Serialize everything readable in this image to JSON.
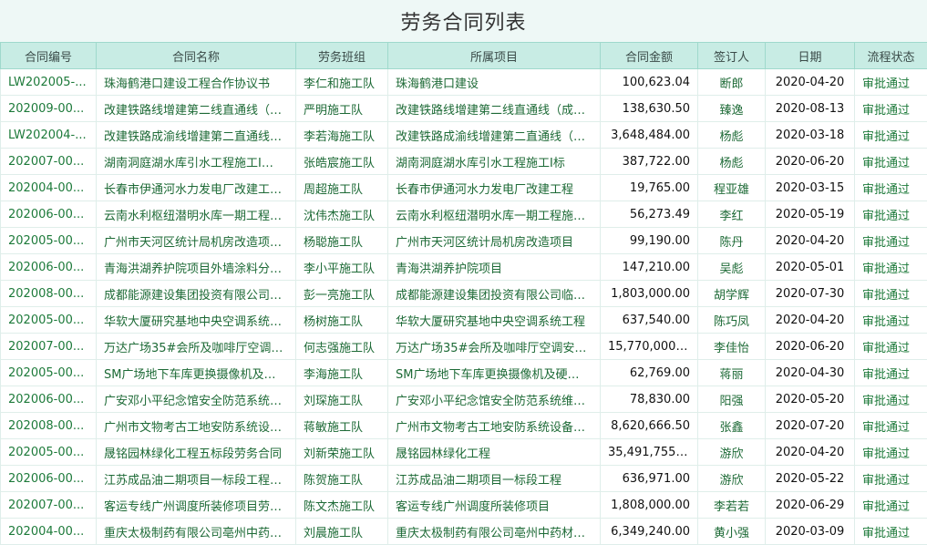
{
  "page": {
    "title": "劳务合同列表"
  },
  "columns": [
    "合同编号",
    "合同名称",
    "劳务班组",
    "所属项目",
    "合同金额",
    "签订人",
    "日期",
    "流程状态"
  ],
  "rows": [
    {
      "code": "LW202005-...",
      "name": "珠海鹤港口建设工程合作协议书",
      "team": "李仁和施工队",
      "project": "珠海鹤港口建设",
      "amount": "100,623.04",
      "signer": "断郎",
      "date": "2020-04-20",
      "status": "审批通过"
    },
    {
      "code": "202009-00...",
      "name": "改建铁路线增建第二线直通线（…",
      "team": "严明施工队",
      "project": "改建铁路线增建第二线直通线（成…",
      "amount": "138,630.50",
      "signer": "臻逸",
      "date": "2020-08-13",
      "status": "审批通过"
    },
    {
      "code": "LW202004-...",
      "name": "改建铁路成渝线增建第二直通线…",
      "team": "李若海施工队",
      "project": "改建铁路成渝线增建第二直通线（…",
      "amount": "3,648,484.00",
      "signer": "杨彪",
      "date": "2020-03-18",
      "status": "审批通过"
    },
    {
      "code": "202007-00...",
      "name": "湖南洞庭湖水库引水工程施工I…",
      "team": "张皓宸施工队",
      "project": "湖南洞庭湖水库引水工程施工I标",
      "amount": "387,722.00",
      "signer": "杨彪",
      "date": "2020-06-20",
      "status": "审批通过"
    },
    {
      "code": "202004-00...",
      "name": "长春市伊通河水力发电厂改建工…",
      "team": "周超施工队",
      "project": "长春市伊通河水力发电厂改建工程",
      "amount": "19,765.00",
      "signer": "程亚雄",
      "date": "2020-03-15",
      "status": "审批通过"
    },
    {
      "code": "202006-00...",
      "name": "云南水利枢纽潜明水库一期工程…",
      "team": "沈伟杰施工队",
      "project": "云南水利枢纽潜明水库一期工程施…",
      "amount": "56,273.49",
      "signer": "李红",
      "date": "2020-05-19",
      "status": "审批通过"
    },
    {
      "code": "202005-00...",
      "name": "广州市天河区统计局机房改造项…",
      "team": "杨聪施工队",
      "project": "广州市天河区统计局机房改造项目",
      "amount": "99,190.00",
      "signer": "陈丹",
      "date": "2020-04-20",
      "status": "审批通过"
    },
    {
      "code": "202006-00...",
      "name": "青海洪湖养护院项目外墙涂料分…",
      "team": "李小平施工队",
      "project": "青海洪湖养护院项目",
      "amount": "147,210.00",
      "signer": "吴彪",
      "date": "2020-05-01",
      "status": "审批通过"
    },
    {
      "code": "202008-00...",
      "name": "成都能源建设集团投资有限公司…",
      "team": "彭一亮施工队",
      "project": "成都能源建设集团投资有限公司临…",
      "amount": "1,803,000.00",
      "signer": "胡学辉",
      "date": "2020-07-30",
      "status": "审批通过"
    },
    {
      "code": "202005-00...",
      "name": "华软大厦研究基地中央空调系统…",
      "team": "杨树施工队",
      "project": "华软大厦研究基地中央空调系统工程",
      "amount": "637,540.00",
      "signer": "陈巧凤",
      "date": "2020-04-20",
      "status": "审批通过"
    },
    {
      "code": "202007-00...",
      "name": "万达广场35#会所及咖啡厅空调…",
      "team": "何志强施工队",
      "project": "万达广场35#会所及咖啡厅空调安…",
      "amount": "15,770,000.00",
      "signer": "李佳怡",
      "date": "2020-06-20",
      "status": "审批通过"
    },
    {
      "code": "202005-00...",
      "name": "SM广场地下车库更换摄像机及…",
      "team": "李海施工队",
      "project": "SM广场地下车库更换摄像机及硬…",
      "amount": "62,769.00",
      "signer": "蒋丽",
      "date": "2020-04-30",
      "status": "审批通过"
    },
    {
      "code": "202006-00...",
      "name": "广安邓小平纪念馆安全防范系统…",
      "team": "刘琛施工队",
      "project": "广安邓小平纪念馆安全防范系统维…",
      "amount": "78,830.00",
      "signer": "阳强",
      "date": "2020-05-20",
      "status": "审批通过"
    },
    {
      "code": "202008-00...",
      "name": "广州市文物考古工地安防系统设…",
      "team": "蒋敏施工队",
      "project": "广州市文物考古工地安防系统设备…",
      "amount": "8,620,666.50",
      "signer": "张鑫",
      "date": "2020-07-20",
      "status": "审批通过"
    },
    {
      "code": "202005-00...",
      "name": "晟铭园林绿化工程五标段劳务合同",
      "team": "刘新荣施工队",
      "project": "晟铭园林绿化工程",
      "amount": "35,491,755.80",
      "signer": "游欣",
      "date": "2020-04-20",
      "status": "审批通过"
    },
    {
      "code": "202006-00...",
      "name": "江苏成品油二期项目一标段工程…",
      "team": "陈贺施工队",
      "project": "江苏成品油二期项目一标段工程",
      "amount": "636,971.00",
      "signer": "游欣",
      "date": "2020-05-22",
      "status": "审批通过"
    },
    {
      "code": "202007-00...",
      "name": "客运专线广州调度所装修项目劳…",
      "team": "陈文杰施工队",
      "project": "客运专线广州调度所装修项目",
      "amount": "1,808,000.00",
      "signer": "李若若",
      "date": "2020-06-29",
      "status": "审批通过"
    },
    {
      "code": "202004-00...",
      "name": "重庆太极制药有限公司亳州中药…",
      "team": "刘晨施工队",
      "project": "重庆太极制药有限公司亳州中药材…",
      "amount": "6,349,240.00",
      "signer": "黄小强",
      "date": "2020-03-09",
      "status": "审批通过"
    }
  ]
}
